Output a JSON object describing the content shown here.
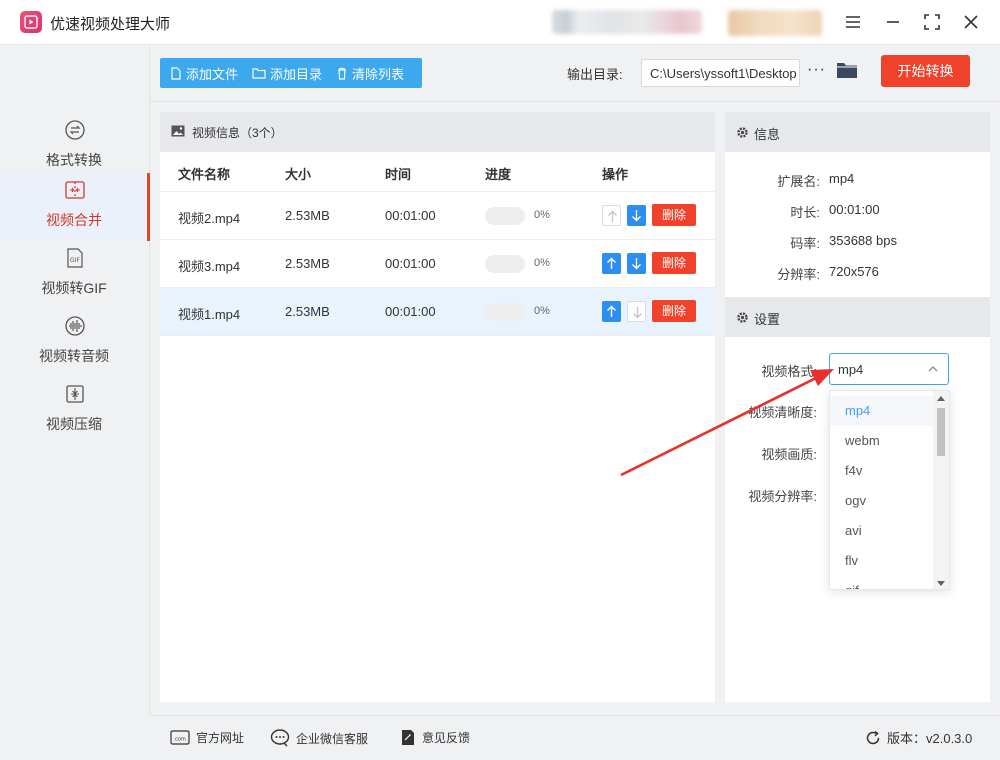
{
  "app": {
    "title": "优速视频处理大师"
  },
  "sidebar": {
    "items": [
      {
        "label": "格式转换",
        "icon": "convert-icon",
        "active": false
      },
      {
        "label": "视频合并",
        "icon": "merge-icon",
        "active": true
      },
      {
        "label": "视频转GIF",
        "icon": "gif-icon",
        "active": false
      },
      {
        "label": "视频转音频",
        "icon": "audio-icon",
        "active": false
      },
      {
        "label": "视频压缩",
        "icon": "compress-icon",
        "active": false
      }
    ]
  },
  "toolbar": {
    "add_file": "添加文件",
    "add_dir": "添加目录",
    "clear_list": "清除列表",
    "output_label": "输出目录:",
    "output_path": "C:\\Users\\yssoft1\\Desktop",
    "more": "···",
    "start": "开始转换"
  },
  "file_panel": {
    "title": "视频信息（3个）",
    "columns": [
      "文件名称",
      "大小",
      "时间",
      "进度",
      "操作"
    ],
    "rows": [
      {
        "name": "视频2.mp4",
        "size": "2.53MB",
        "time": "00:01:00",
        "progress": "0%",
        "up_enabled": false,
        "down_enabled": true,
        "selected": false
      },
      {
        "name": "视频3.mp4",
        "size": "2.53MB",
        "time": "00:01:00",
        "progress": "0%",
        "up_enabled": true,
        "down_enabled": true,
        "selected": false
      },
      {
        "name": "视频1.mp4",
        "size": "2.53MB",
        "time": "00:01:00",
        "progress": "0%",
        "up_enabled": true,
        "down_enabled": false,
        "selected": true
      }
    ],
    "delete_label": "删除"
  },
  "info": {
    "title": "信息",
    "ext_label": "扩展名:",
    "ext": "mp4",
    "duration_label": "时长:",
    "duration": "00:01:00",
    "bitrate_label": "码率:",
    "bitrate": "353688 bps",
    "resolution_label": "分辨率:",
    "resolution": "720x576"
  },
  "settings": {
    "title": "设置",
    "format_label": "视频格式:",
    "format_value": "mp4",
    "clarity_label": "视频清晰度:",
    "quality_label": "视频画质:",
    "resolution_label": "视频分辨率:",
    "format_options": [
      "mp4",
      "webm",
      "f4v",
      "ogv",
      "avi",
      "flv",
      "gif"
    ]
  },
  "footer": {
    "website": "官方网址",
    "wechat": "企业微信客服",
    "feedback": "意见反馈",
    "version": "版本：v2.0.3.0"
  },
  "colors": {
    "accent_blue": "#3ca8ee",
    "start_red": "#f0422b",
    "active_nav": "#d33a2c",
    "arrow_red": "#e8312c"
  }
}
